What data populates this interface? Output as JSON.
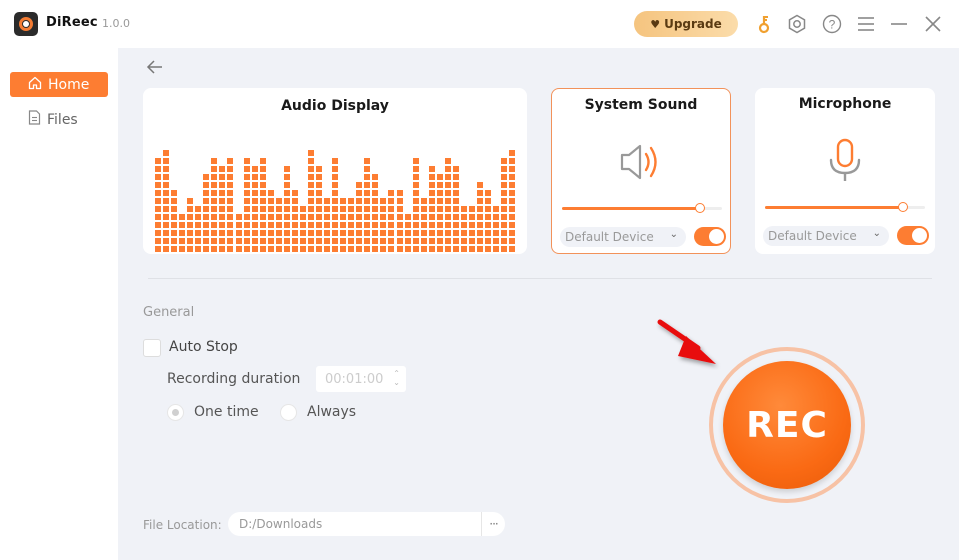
{
  "app": {
    "name": "DiReec",
    "version": "1.0.0",
    "accent_color": "#fd7d32"
  },
  "titlebar": {
    "upgrade_label": "Upgrade",
    "icons": [
      "key-icon",
      "settings-icon",
      "help-icon",
      "menu-icon",
      "minimize-icon",
      "close-icon"
    ]
  },
  "sidebar": {
    "items": [
      {
        "label": "Home",
        "icon": "home-icon",
        "active": true
      },
      {
        "label": "Files",
        "icon": "file-icon",
        "active": false
      }
    ]
  },
  "audio_display": {
    "title": "Audio Display",
    "max_level": 13,
    "levels": [
      12,
      13,
      8,
      5,
      7,
      6,
      10,
      12,
      11,
      12,
      5,
      12,
      11,
      12,
      8,
      7,
      11,
      8,
      6,
      13,
      11,
      7,
      12,
      7,
      7,
      9,
      12,
      10,
      7,
      8,
      8,
      5,
      12,
      7,
      11,
      10,
      12,
      11,
      6,
      6,
      9,
      8,
      6,
      12,
      13
    ]
  },
  "system_sound": {
    "title": "System Sound",
    "icon": "speaker-icon",
    "volume_percent": 86,
    "device": "Default Device",
    "enabled": true
  },
  "microphone": {
    "title": "Microphone",
    "icon": "microphone-icon",
    "volume_percent": 86,
    "device": "Default Device",
    "enabled": true
  },
  "general": {
    "section_label": "General",
    "auto_stop_label": "Auto Stop",
    "auto_stop_checked": false,
    "duration_label": "Recording duration",
    "duration_value": "00:01:00",
    "radio_options": [
      {
        "label": "One time",
        "checked": true
      },
      {
        "label": "Always",
        "checked": false
      }
    ]
  },
  "rec_button": {
    "label": "REC"
  },
  "file_location": {
    "label": "File Location:",
    "value": "D:/Downloads",
    "more_label": "···"
  }
}
